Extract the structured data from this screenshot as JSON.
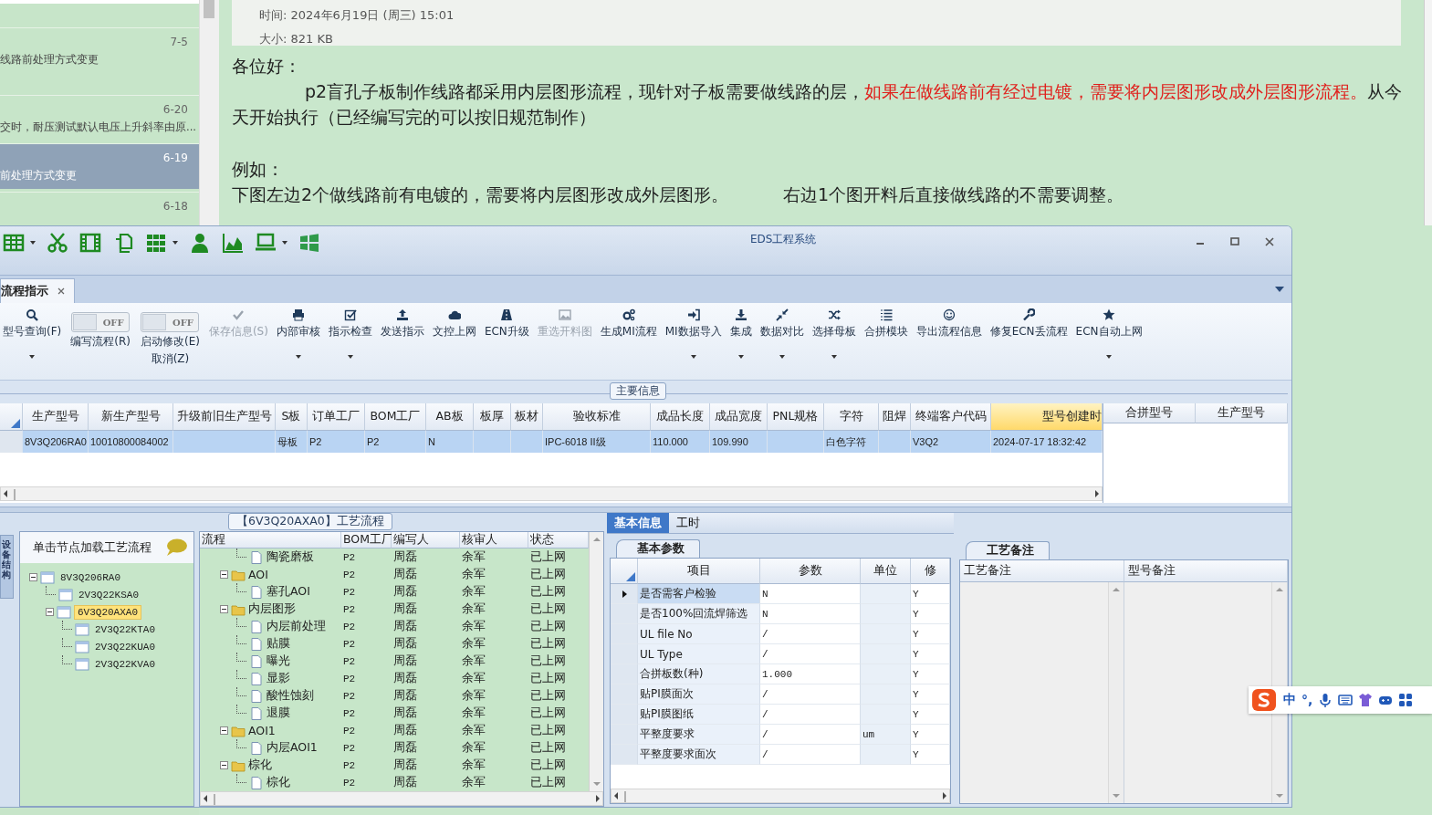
{
  "mail_list": {
    "items": [
      {
        "date": "7-5",
        "snippet": "线路前处理方式变更",
        "selected": false
      },
      {
        "date": "6-20",
        "snippet": "交时，耐压测试默认电压上升斜率由原...",
        "selected": false
      },
      {
        "date": "6-19",
        "snippet": "前处理方式变更",
        "selected": true
      },
      {
        "date": "6-18",
        "selected": false
      }
    ]
  },
  "mail": {
    "time": "时间: 2024年6月19日 (周三) 15:01",
    "size": "大小: 821 KB",
    "body": [
      {
        "kind": "plain",
        "text": "各位好："
      },
      {
        "kind": "indented",
        "segments": [
          {
            "text": "p2盲孔子板制作线路都采用内层图形流程，现针对子板需要做线路的层，",
            "highlight": false
          },
          {
            "text": "如果在做线路前有经过电镀，需要将内层图形改成外层图形流程。",
            "highlight": true
          },
          {
            "text": "从今天开始执行（已经编写完的可以按旧规范制作）",
            "highlight": false
          }
        ]
      },
      {
        "kind": "plain",
        "text": "例如："
      },
      {
        "kind": "pair",
        "left": "下图左边2个做线路前有电镀的，需要将内层图形改成外层图形。",
        "right": "右边1个图开料后直接做线路的不需要调整。"
      }
    ]
  },
  "app": {
    "title": "EDS工程系统",
    "quick_tools": [
      {
        "dropdown": true
      },
      {
        "dropdown": false
      },
      {
        "dropdown": false
      },
      {
        "dropdown": false
      },
      {
        "dropdown": true
      },
      {
        "dropdown": false
      },
      {
        "dropdown": false
      },
      {
        "dropdown": true
      },
      {
        "dropdown": false
      }
    ],
    "doc_tabs": [
      {
        "label": "流程指示",
        "selected": true
      }
    ],
    "ribbon": [
      {
        "kind": "button",
        "label": "型号查询(F)",
        "dropdown": true,
        "disabled": false
      },
      {
        "kind": "toggle",
        "label": "编写流程(R)",
        "switch_text": "OFF",
        "on": false
      },
      {
        "kind": "toggle",
        "label": "启动修改(E)",
        "sublabel": "取消(Z)",
        "switch_text": "OFF",
        "on": false
      },
      {
        "kind": "button",
        "label": "保存信息(S)",
        "dropdown": false,
        "disabled": true
      },
      {
        "kind": "button",
        "label": "内部审核",
        "dropdown": true,
        "disabled": false
      },
      {
        "kind": "button",
        "label": "指示检查",
        "dropdown": true,
        "disabled": false
      },
      {
        "kind": "button",
        "label": "发送指示",
        "dropdown": false,
        "disabled": false
      },
      {
        "kind": "button",
        "label": "文控上网",
        "dropdown": false,
        "disabled": false
      },
      {
        "kind": "button",
        "label": "ECN升级",
        "dropdown": false,
        "disabled": false
      },
      {
        "kind": "button",
        "label": "重选开料图",
        "dropdown": false,
        "disabled": true
      },
      {
        "kind": "button",
        "label": "生成MI流程",
        "dropdown": false,
        "disabled": false
      },
      {
        "kind": "button",
        "label": "MI数据导入",
        "dropdown": true,
        "disabled": false
      },
      {
        "kind": "button",
        "label": "集成",
        "dropdown": true,
        "disabled": false
      },
      {
        "kind": "button",
        "label": "数据对比",
        "dropdown": true,
        "disabled": false
      },
      {
        "kind": "button",
        "label": "选择母板",
        "dropdown": true,
        "disabled": false
      },
      {
        "kind": "button",
        "label": "合拼模块",
        "dropdown": false,
        "disabled": false
      },
      {
        "kind": "button",
        "label": "导出流程信息",
        "dropdown": false,
        "disabled": false
      },
      {
        "kind": "button",
        "label": "修复ECN丢流程",
        "dropdown": false,
        "disabled": false
      },
      {
        "kind": "button",
        "label": "ECN自动上网",
        "dropdown": true,
        "disabled": false
      }
    ],
    "main_info": {
      "title": "主要信息",
      "columns": [
        {
          "label": "生产型号",
          "highlighted": false
        },
        {
          "label": "新生产型号",
          "highlighted": false
        },
        {
          "label": "升级前旧生产型号",
          "highlighted": false
        },
        {
          "label": "S板",
          "highlighted": false
        },
        {
          "label": "订单工厂",
          "highlighted": false
        },
        {
          "label": "BOM工厂",
          "highlighted": false
        },
        {
          "label": "AB板",
          "highlighted": false
        },
        {
          "label": "板厚",
          "highlighted": false
        },
        {
          "label": "板材",
          "highlighted": false
        },
        {
          "label": "验收标准",
          "highlighted": false
        },
        {
          "label": "成品长度",
          "highlighted": false
        },
        {
          "label": "成品宽度",
          "highlighted": false
        },
        {
          "label": "PNL规格",
          "highlighted": false
        },
        {
          "label": "字符",
          "highlighted": false
        },
        {
          "label": "阻焊",
          "highlighted": false
        },
        {
          "label": "终端客户代码",
          "highlighted": false
        },
        {
          "label": "型号创建时",
          "highlighted": true
        }
      ],
      "rows": [
        {
          "selected": true,
          "cells": [
            "8V3Q206RA0",
            "10010800084002",
            null,
            "母板",
            "P2",
            "P2",
            "N",
            null,
            null,
            "IPC-6018 II级",
            "110.000",
            "109.990",
            null,
            "白色字符",
            null,
            "V3Q2",
            "2024-07-17 18:32:42"
          ]
        }
      ],
      "side_columns": [
        "合拼型号",
        "生产型号"
      ]
    },
    "device_tab": {
      "label": "设备结构"
    },
    "tree": {
      "hint": "单击节点加载工艺流程",
      "nodes": [
        {
          "label": "8V3Q206RA0",
          "selected": false,
          "expanded": true,
          "children": [
            {
              "label": "2V3Q22KSA0",
              "selected": false
            },
            {
              "label": "6V3Q20AXA0",
              "selected": true,
              "expanded": true,
              "children": [
                {
                  "label": "2V3Q22KTA0",
                  "selected": false
                },
                {
                  "label": "2V3Q22KUA0",
                  "selected": false
                },
                {
                  "label": "2V3Q22KVA0",
                  "selected": false
                }
              ]
            }
          ]
        }
      ]
    },
    "flow": {
      "title": "【6V3Q20AXA0】工艺流程",
      "columns": [
        "流程",
        "BOM工厂",
        "编写人",
        "核审人",
        "状态"
      ],
      "rows": [
        {
          "kind": "step",
          "name": "陶瓷磨板",
          "bom": "P2",
          "writer": "周磊",
          "reviewer": "余军",
          "status": "已上网"
        },
        {
          "kind": "group",
          "name": "AOI",
          "bom": "P2",
          "writer": "周磊",
          "reviewer": "余军",
          "status": "已上网",
          "expanded": true,
          "children": [
            {
              "kind": "step",
              "name": "塞孔AOI",
              "bom": "P2",
              "writer": "周磊",
              "reviewer": "余军",
              "status": "已上网"
            }
          ]
        },
        {
          "kind": "group",
          "name": "内层图形",
          "bom": "P2",
          "writer": "周磊",
          "reviewer": "余军",
          "status": "已上网",
          "expanded": true,
          "children": [
            {
              "kind": "step",
              "name": "内层前处理",
              "bom": "P2",
              "writer": "周磊",
              "reviewer": "余军",
              "status": "已上网"
            },
            {
              "kind": "step",
              "name": "贴膜",
              "bom": "P2",
              "writer": "周磊",
              "reviewer": "余军",
              "status": "已上网"
            },
            {
              "kind": "step",
              "name": "曝光",
              "bom": "P2",
              "writer": "周磊",
              "reviewer": "余军",
              "status": "已上网"
            },
            {
              "kind": "step",
              "name": "显影",
              "bom": "P2",
              "writer": "周磊",
              "reviewer": "余军",
              "status": "已上网"
            },
            {
              "kind": "step",
              "name": "酸性蚀刻",
              "bom": "P2",
              "writer": "周磊",
              "reviewer": "余军",
              "status": "已上网"
            },
            {
              "kind": "step",
              "name": "退膜",
              "bom": "P2",
              "writer": "周磊",
              "reviewer": "余军",
              "status": "已上网"
            }
          ]
        },
        {
          "kind": "group",
          "name": "AOI1",
          "bom": "P2",
          "writer": "周磊",
          "reviewer": "余军",
          "status": "已上网",
          "expanded": true,
          "children": [
            {
              "kind": "step",
              "name": "内层AOI1",
              "bom": "P2",
              "writer": "周磊",
              "reviewer": "余军",
              "status": "已上网"
            }
          ]
        },
        {
          "kind": "group",
          "name": "棕化",
          "bom": "P2",
          "writer": "周磊",
          "reviewer": "余军",
          "status": "已上网",
          "expanded": true,
          "children": [
            {
              "kind": "step",
              "name": "棕化",
              "bom": "P2",
              "writer": "周磊",
              "reviewer": "余军",
              "status": "已上网"
            }
          ]
        }
      ]
    },
    "details": {
      "tabs": [
        {
          "label": "基本信息",
          "selected": true
        },
        {
          "label": "工时",
          "selected": false
        }
      ],
      "params": {
        "tab": "基本参数",
        "columns": [
          "项目",
          "参数",
          "单位",
          "修"
        ],
        "rows": [
          {
            "item": "是否需客户检验",
            "value": "N",
            "unit": null,
            "modified": "Y",
            "current": true
          },
          {
            "item": "是否100%回流焊筛选",
            "value": "N",
            "unit": null,
            "modified": "Y",
            "current": false
          },
          {
            "item": "UL file No",
            "value": "/",
            "unit": null,
            "modified": "Y",
            "current": false
          },
          {
            "item": "UL Type",
            "value": "/",
            "unit": null,
            "modified": "Y",
            "current": false
          },
          {
            "item": "合拼板数(种)",
            "value": "1.000",
            "unit": null,
            "modified": "Y",
            "current": false
          },
          {
            "item": "贴PI膜面次",
            "value": "/",
            "unit": null,
            "modified": "Y",
            "current": false
          },
          {
            "item": "贴PI膜图纸",
            "value": "/",
            "unit": null,
            "modified": "Y",
            "current": false
          },
          {
            "item": "平整度要求",
            "value": "/",
            "unit": "um",
            "modified": "Y",
            "current": false
          },
          {
            "item": "平整度要求面次",
            "value": "/",
            "unit": null,
            "modified": "Y",
            "current": false
          }
        ]
      },
      "remarks": {
        "tab": "工艺备注",
        "columns": [
          "工艺备注",
          "型号备注"
        ]
      }
    }
  },
  "ime": {
    "mode": "中",
    "punct": "°,"
  }
}
